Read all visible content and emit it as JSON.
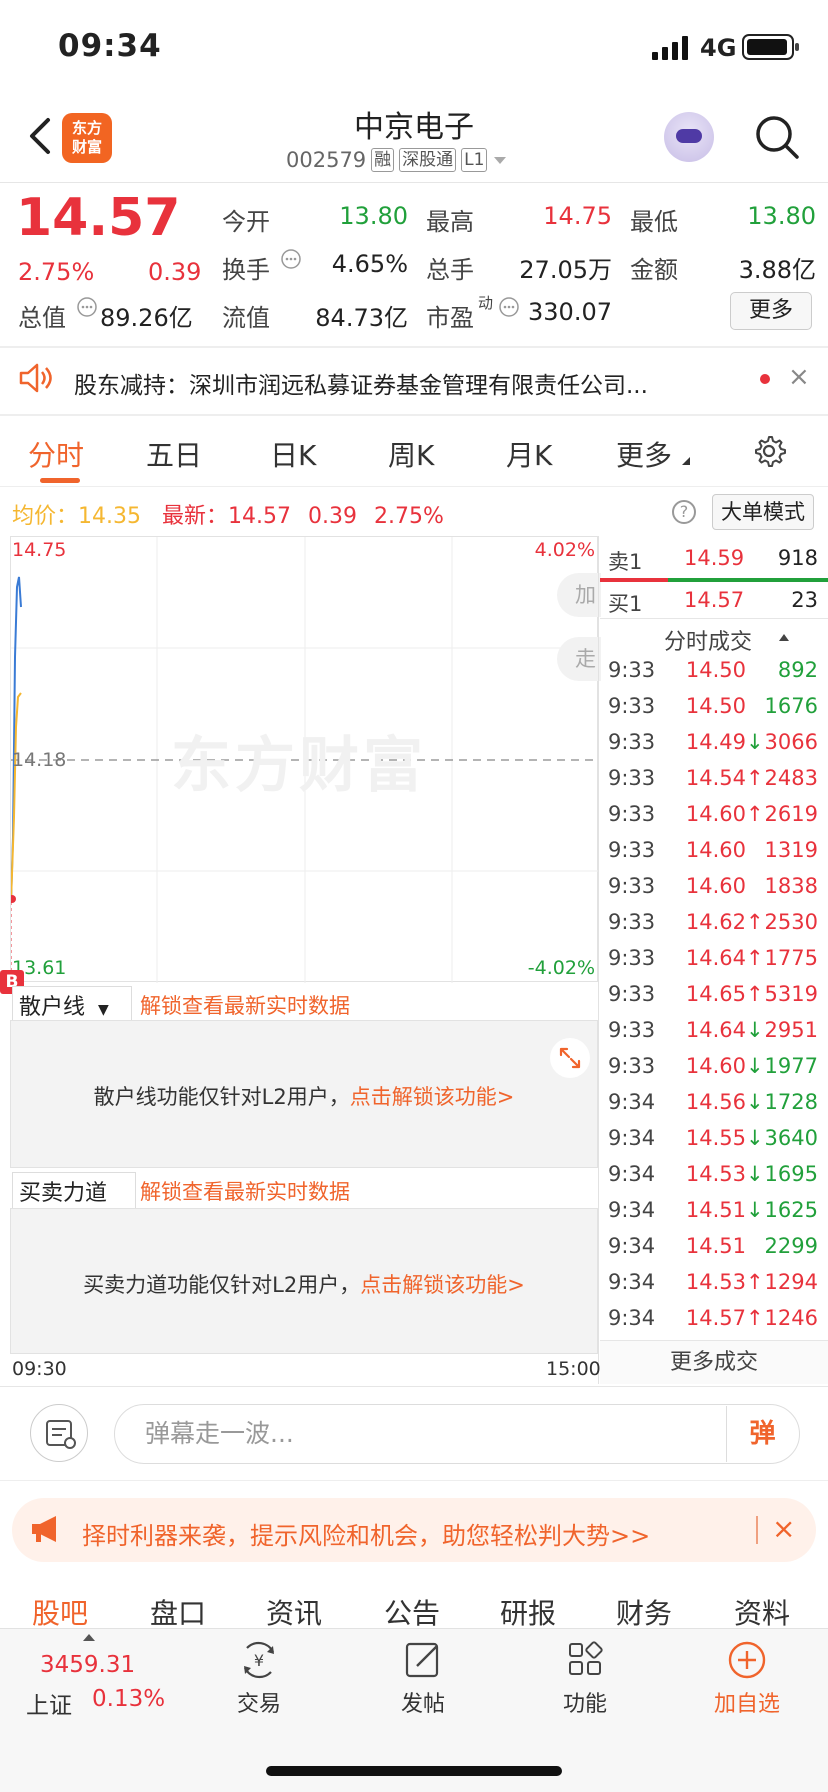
{
  "status": {
    "time": "09:34",
    "network": "4G"
  },
  "header": {
    "logo_line1": "东方",
    "logo_line2": "财富",
    "name": "中京电子",
    "code": "002579",
    "tags": [
      "融",
      "深股通",
      "L1"
    ]
  },
  "quote": {
    "price": "14.57",
    "pct": "2.75%",
    "change": "0.39",
    "stats": [
      {
        "label": "今开",
        "value": "13.80",
        "color": "green"
      },
      {
        "label": "最高",
        "value": "14.75",
        "color": "red"
      },
      {
        "label": "最低",
        "value": "13.80",
        "color": "green"
      },
      {
        "label": "换手",
        "value": "4.65%",
        "color": "dark"
      },
      {
        "label": "总手",
        "value": "27.05万",
        "color": "dark"
      },
      {
        "label": "金额",
        "value": "3.88亿",
        "color": "dark"
      },
      {
        "label": "总值",
        "value": "89.26亿",
        "color": "dark"
      },
      {
        "label": "流值",
        "value": "84.73亿",
        "color": "dark"
      },
      {
        "label": "市盈",
        "value": "330.07",
        "color": "dark"
      }
    ],
    "pe_sup": "动",
    "more_label": "更多"
  },
  "notice": {
    "text": "股东减持：深圳市润远私募证券基金管理有限责任公司...",
    "close": "×"
  },
  "tabs": [
    "分时",
    "五日",
    "日K",
    "周K",
    "月K",
    "更多"
  ],
  "info": {
    "avg_label": "均价：",
    "avg_value": "14.35",
    "latest_label": "最新：",
    "latest_value": "14.57",
    "latest_change": "0.39",
    "latest_pct": "2.75%",
    "help": "?",
    "bigorder_label": "大单模式"
  },
  "chart": {
    "watermark": "东方财富",
    "high_price": "14.75",
    "mid_price": "14.18",
    "low_price": "13.61",
    "high_pct": "4.02%",
    "low_pct": "-4.02%",
    "start_time": "09:30",
    "end_time": "15:00",
    "side_btn1": "加",
    "side_btn2": "走",
    "b_marker": "B",
    "colors": {
      "price_line": "#3a7bd5",
      "avg_line": "#f5b731"
    }
  },
  "orderbook": {
    "sell1_label": "卖1",
    "sell1_price": "14.59",
    "sell1_vol": "918",
    "buy1_label": "买1",
    "buy1_price": "14.57",
    "buy1_vol": "23",
    "trades_title": "分时成交",
    "trades": [
      {
        "t": "9:33",
        "p": "14.50",
        "dir": "",
        "v": "892",
        "pc": "red",
        "vc": "green"
      },
      {
        "t": "9:33",
        "p": "14.50",
        "dir": "",
        "v": "1676",
        "pc": "red",
        "vc": "green"
      },
      {
        "t": "9:33",
        "p": "14.49",
        "dir": "↓",
        "v": "3066",
        "pc": "red",
        "vc": "red"
      },
      {
        "t": "9:33",
        "p": "14.54",
        "dir": "↑",
        "v": "2483",
        "pc": "red",
        "vc": "red"
      },
      {
        "t": "9:33",
        "p": "14.60",
        "dir": "↑",
        "v": "2619",
        "pc": "red",
        "vc": "red"
      },
      {
        "t": "9:33",
        "p": "14.60",
        "dir": "",
        "v": "1319",
        "pc": "red",
        "vc": "red"
      },
      {
        "t": "9:33",
        "p": "14.60",
        "dir": "",
        "v": "1838",
        "pc": "red",
        "vc": "red"
      },
      {
        "t": "9:33",
        "p": "14.62",
        "dir": "↑",
        "v": "2530",
        "pc": "red",
        "vc": "red"
      },
      {
        "t": "9:33",
        "p": "14.64",
        "dir": "↑",
        "v": "1775",
        "pc": "red",
        "vc": "red"
      },
      {
        "t": "9:33",
        "p": "14.65",
        "dir": "↑",
        "v": "5319",
        "pc": "red",
        "vc": "red"
      },
      {
        "t": "9:33",
        "p": "14.64",
        "dir": "↓",
        "v": "2951",
        "pc": "red",
        "vc": "red"
      },
      {
        "t": "9:33",
        "p": "14.60",
        "dir": "↓",
        "v": "1977",
        "pc": "red",
        "vc": "green"
      },
      {
        "t": "9:34",
        "p": "14.56",
        "dir": "↓",
        "v": "1728",
        "pc": "red",
        "vc": "green"
      },
      {
        "t": "9:34",
        "p": "14.55",
        "dir": "↓",
        "v": "3640",
        "pc": "red",
        "vc": "green"
      },
      {
        "t": "9:34",
        "p": "14.53",
        "dir": "↓",
        "v": "1695",
        "pc": "red",
        "vc": "green"
      },
      {
        "t": "9:34",
        "p": "14.51",
        "dir": "↓",
        "v": "1625",
        "pc": "red",
        "vc": "green"
      },
      {
        "t": "9:34",
        "p": "14.51",
        "dir": "",
        "v": "2299",
        "pc": "red",
        "vc": "green"
      },
      {
        "t": "9:34",
        "p": "14.53",
        "dir": "↑",
        "v": "1294",
        "pc": "red",
        "vc": "red"
      },
      {
        "t": "9:34",
        "p": "14.57",
        "dir": "↑",
        "v": "1246",
        "pc": "red",
        "vc": "red"
      }
    ],
    "more_trades": "更多成交"
  },
  "retail_panel": {
    "select": "散户线",
    "unlock_hint": "解锁查看最新实时数据",
    "body": "散户线功能仅针对L2用户，",
    "link": "点击解锁该功能>"
  },
  "force_panel": {
    "select": "买卖力道",
    "unlock_hint": "解锁查看最新实时数据",
    "body": "买卖力道功能仅针对L2用户，",
    "link": "点击解锁该功能>"
  },
  "danmaku": {
    "placeholder": "弹幕走一波...",
    "button": "弹"
  },
  "promo": {
    "text": "择时利器来袭，提示风险和机会，助您轻松判大势>>",
    "close": "×"
  },
  "bottom_tabs": [
    "股吧",
    "盘口",
    "资讯",
    "公告",
    "研报",
    "财务",
    "资料"
  ],
  "bottombar": {
    "index_value": "3459.31",
    "index_name": "上证",
    "index_pct": "0.13%",
    "items": [
      "交易",
      "发帖",
      "功能",
      "加自选"
    ]
  }
}
